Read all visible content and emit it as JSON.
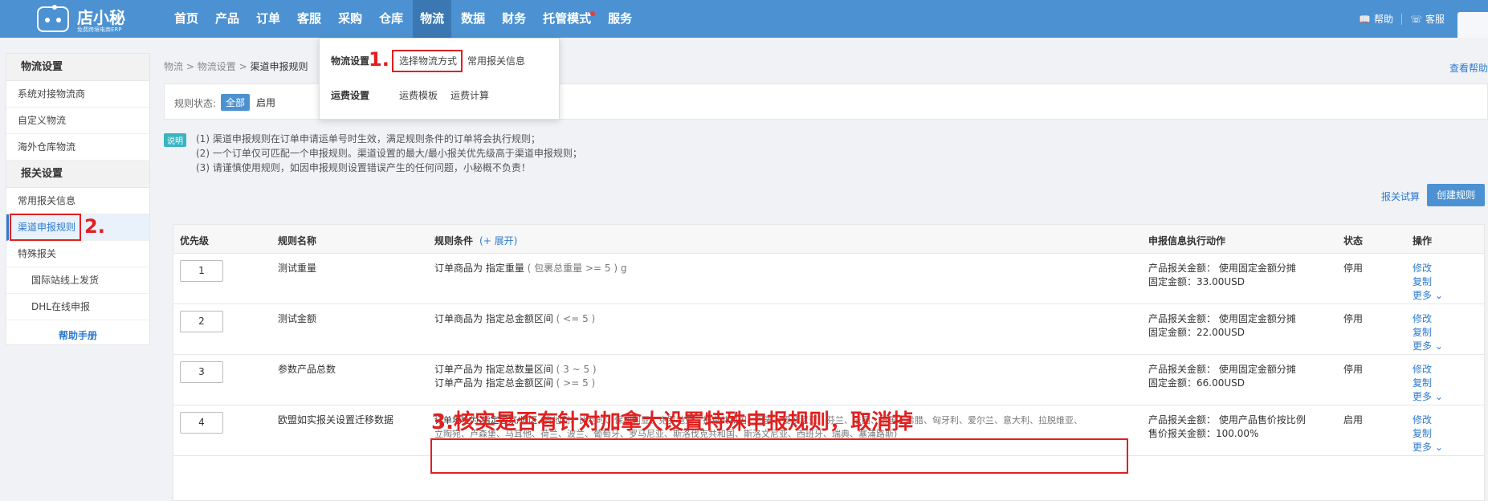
{
  "app": {
    "logo_name": "店小秘",
    "logo_sub": "免费跨境电商ERP"
  },
  "nav": {
    "items": [
      "首页",
      "产品",
      "订单",
      "客服",
      "采购",
      "仓库",
      "物流",
      "数据",
      "财务",
      "托管模式",
      "服务"
    ],
    "active": "物流",
    "help": "帮助",
    "service": "客服"
  },
  "dropdown": {
    "group1": "物流设置",
    "item1": "选择物流方式",
    "item2": "常用报关信息",
    "group2": "运费设置",
    "item3": "运费模板",
    "item4": "运费计算"
  },
  "sidebar": {
    "section1": "物流设置",
    "items1": [
      "系统对接物流商",
      "自定义物流",
      "海外仓库物流"
    ],
    "section2": "报关设置",
    "items2": [
      "常用报关信息",
      "渠道申报规则",
      "特殊报关"
    ],
    "sub_items": [
      "国际站线上发货",
      "DHL在线申报"
    ],
    "help": "帮助手册"
  },
  "breadcrumb": {
    "p1": "物流",
    "p2": "物流设置",
    "current": "渠道申报规则",
    "sep": ">"
  },
  "header": {
    "help_link": "查看帮助",
    "filter_label": "规则状态:",
    "filter_all": "全部",
    "filter_on": "启用"
  },
  "notice": {
    "tag": "说明",
    "lines": [
      "(1) 渠道申报规则在订单申请运单号时生效，满足规则条件的订单将会执行规则；",
      "(2) 一个订单仅可匹配一个申报规则。渠道设置的最大/最小报关优先级高于渠道申报规则；",
      "(3) 请谨慎使用规则，如因申报规则设置错误产生的任何问题，小秘概不负责！"
    ]
  },
  "actions": {
    "test": "报关试算",
    "create": "创建规则"
  },
  "table": {
    "headers": {
      "priority": "优先级",
      "name": "规则名称",
      "condition": "规则条件",
      "expand": "(+ 展开)",
      "action": "申报信息执行动作",
      "status": "状态",
      "ops": "操作"
    },
    "rows": [
      {
        "priority": "1",
        "name": "测试重量",
        "cond1": "订单商品为 指定重量",
        "cond1_extra": "( 包裹总重量 >= 5 ) g",
        "cond2": "",
        "cond2_extra": "",
        "action1": "产品报关金额： 使用固定金额分摊",
        "action2": "固定金额：33.00USD",
        "status": "停用"
      },
      {
        "priority": "2",
        "name": "测试金额",
        "cond1": "订单商品为 指定总金额区间",
        "cond1_extra": "( <= 5 )",
        "cond2": "",
        "cond2_extra": "",
        "action1": "产品报关金额： 使用固定金额分摊",
        "action2": "固定金额：22.00USD",
        "status": "停用"
      },
      {
        "priority": "3",
        "name": "参数产品总数",
        "cond1": "订单产品为 指定总数量区间",
        "cond1_extra": "( 3 ~ 5 )",
        "cond2": "订单产品为 指定总金额区间",
        "cond2_extra": "( >= 5 )",
        "action1": "产品报关金额： 使用固定金额分摊",
        "action2": "固定金额：66.00USD",
        "status": "停用"
      },
      {
        "priority": "4",
        "name": "欧盟如实报关设置迁移数据",
        "cond1": "订单地址为 指定国家/地区",
        "cond1_extra": "(奥地利、比利时、保加利亚、克罗地亚、捷克共和国、丹麦、爱沙尼亚、芬兰、法国、德国、希腊、匈牙利、爱尔兰、意大利、拉脱维亚、",
        "cond2": "立陶宛、卢森堡、马耳他、荷兰、波兰、葡萄牙、罗马尼亚、斯洛伐克共和国、斯洛文尼亚、西班牙、瑞典、塞浦路斯)",
        "cond2_extra": "",
        "action1": "产品报关金额： 使用产品售价按比例",
        "action2": "售价报关金额：100.00%",
        "status": "启用"
      }
    ],
    "ops": [
      "修改",
      "复制",
      "更多"
    ]
  },
  "annotations": {
    "a1": "1.",
    "a2": "2.",
    "a3": "3.核实是否有针对加拿大设置特殊申报规则，取消掉"
  },
  "colors": {
    "brand": "#4c92d2",
    "annotation": "#e02020",
    "status_off": "#e02020",
    "status_on": "#19a94b"
  }
}
